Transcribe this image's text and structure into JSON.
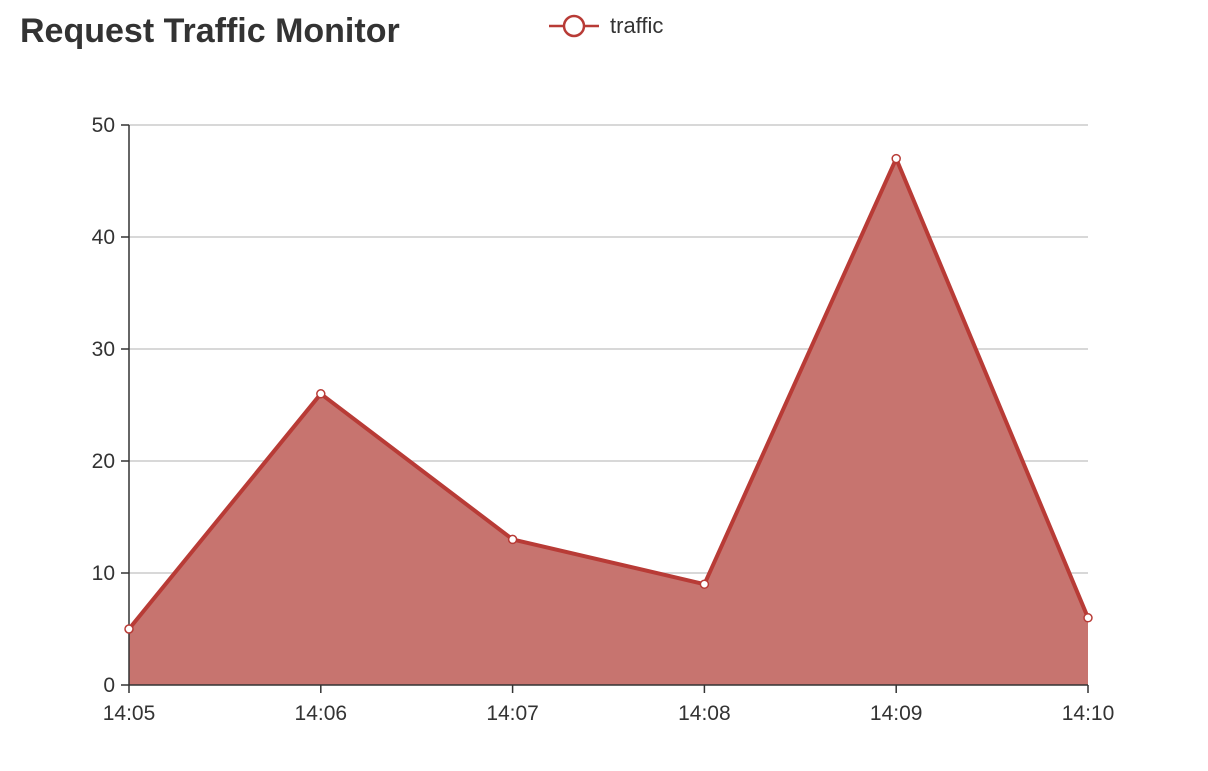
{
  "chart_data": {
    "type": "area",
    "title": "Request Traffic Monitor",
    "xlabel": "",
    "ylabel": "",
    "categories": [
      "14:05",
      "14:06",
      "14:07",
      "14:08",
      "14:09",
      "14:10"
    ],
    "series": [
      {
        "name": "traffic",
        "values": [
          5,
          26,
          13,
          9,
          47,
          6
        ],
        "line_color": "#b83b36",
        "fill_color": "#c7746f"
      }
    ],
    "ylim": [
      0,
      50
    ],
    "yticks": [
      0,
      10,
      20,
      30,
      40,
      50
    ],
    "grid": true,
    "legend_position": "top-center"
  }
}
